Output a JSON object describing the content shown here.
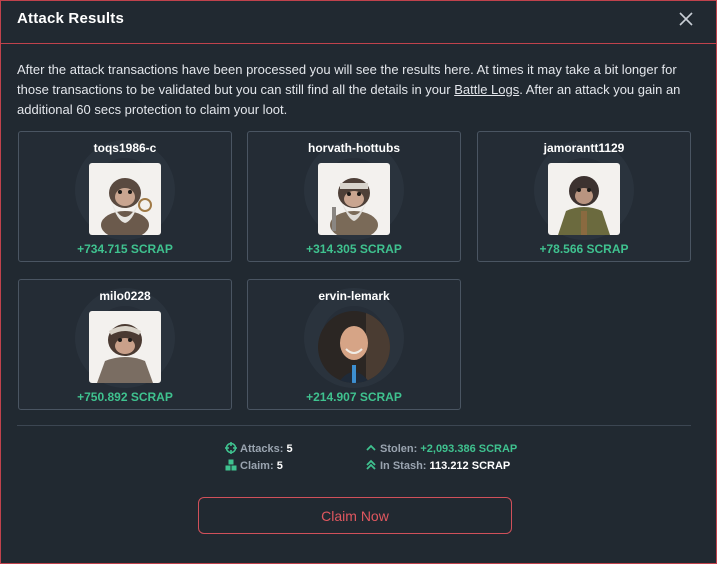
{
  "modal": {
    "title": "Attack Results",
    "intro_text_1": "After the attack transactions have been processed you will see the results here. At times it may take a bit longer for those transactions to be validated but you can still find all the details in your ",
    "battle_logs_link": "Battle Logs",
    "intro_text_2": ". After an attack you gain an additional 60 secs protection to claim your loot."
  },
  "results": [
    {
      "name": "toqs1986-c",
      "scrap": "+734.715 SCRAP"
    },
    {
      "name": "horvath-hottubs",
      "scrap": "+314.305 SCRAP"
    },
    {
      "name": "jamorantt1129",
      "scrap": "+78.566 SCRAP"
    },
    {
      "name": "milo0228",
      "scrap": "+750.892 SCRAP"
    },
    {
      "name": "ervin-lemark",
      "scrap": "+214.907 SCRAP"
    }
  ],
  "summary": {
    "attacks_label": "Attacks:",
    "attacks_value": "5",
    "claim_label": "Claim:",
    "claim_value": "5",
    "stolen_label": "Stolen:",
    "stolen_value": "+2,093.386 SCRAP",
    "stash_label": "In Stash:",
    "stash_value": "113.212 SCRAP"
  },
  "claim_button_label": "Claim Now",
  "colors": {
    "accent": "#c0424c",
    "positive": "#3fc28f",
    "background": "#212931"
  },
  "icons": {
    "close": "close-icon",
    "attacks": "crosshair-icon",
    "claim": "boxes-icon",
    "stolen": "chevron-up-icon",
    "stash": "double-chevron-up-icon"
  }
}
